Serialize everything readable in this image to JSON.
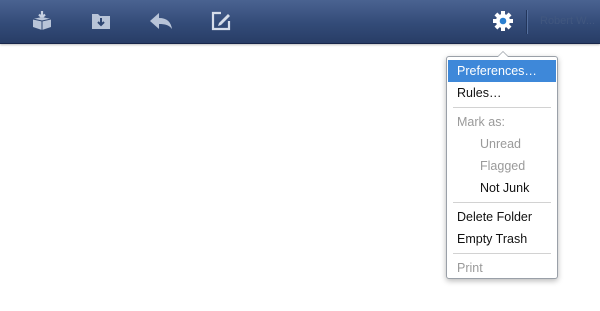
{
  "toolbar": {
    "buttons": [
      {
        "icon": "archive-download-icon"
      },
      {
        "icon": "move-to-folder-icon"
      },
      {
        "icon": "reply-icon"
      },
      {
        "icon": "compose-icon"
      },
      {
        "icon": "gear-icon"
      }
    ],
    "user_label": "Robert W..."
  },
  "menu": {
    "preferences": "Preferences…",
    "rules": "Rules…",
    "mark_as": "Mark as:",
    "unread": "Unread",
    "flagged": "Flagged",
    "not_junk": "Not Junk",
    "delete_folder": "Delete Folder",
    "empty_trash": "Empty Trash",
    "print": "Print"
  },
  "colors": {
    "toolbar_top": "#4a6391",
    "toolbar_bottom": "#283d66",
    "highlight": "#3e88d9",
    "disabled_text": "#9a9a9a"
  }
}
